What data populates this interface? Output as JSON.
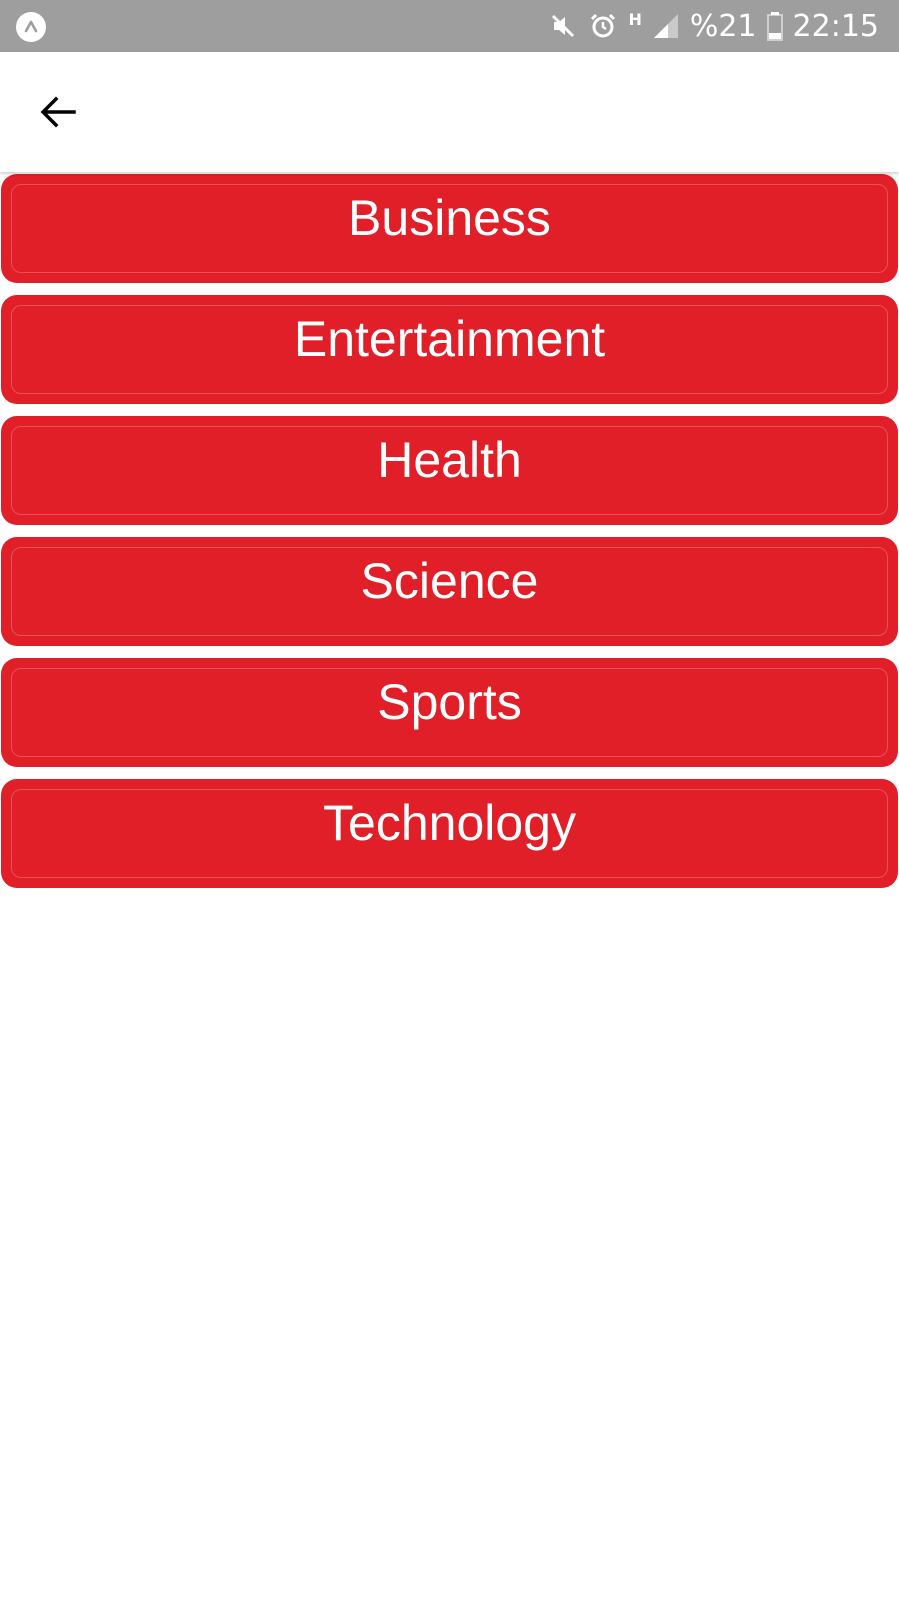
{
  "status_bar": {
    "battery_text": "%21",
    "time": "22:15",
    "network_type": "H",
    "icons": [
      "app-notification-icon",
      "mute-icon",
      "alarm-icon",
      "network-h-icon",
      "signal-icon",
      "battery-icon"
    ]
  },
  "app_bar": {
    "back_icon": "arrow-back-icon"
  },
  "categories": [
    {
      "label": "Business"
    },
    {
      "label": "Entertainment"
    },
    {
      "label": "Health"
    },
    {
      "label": "Science"
    },
    {
      "label": "Sports"
    },
    {
      "label": "Technology"
    }
  ],
  "colors": {
    "accent": "#e11f28",
    "status_bar": "#9e9e9e",
    "background": "#ffffff"
  }
}
